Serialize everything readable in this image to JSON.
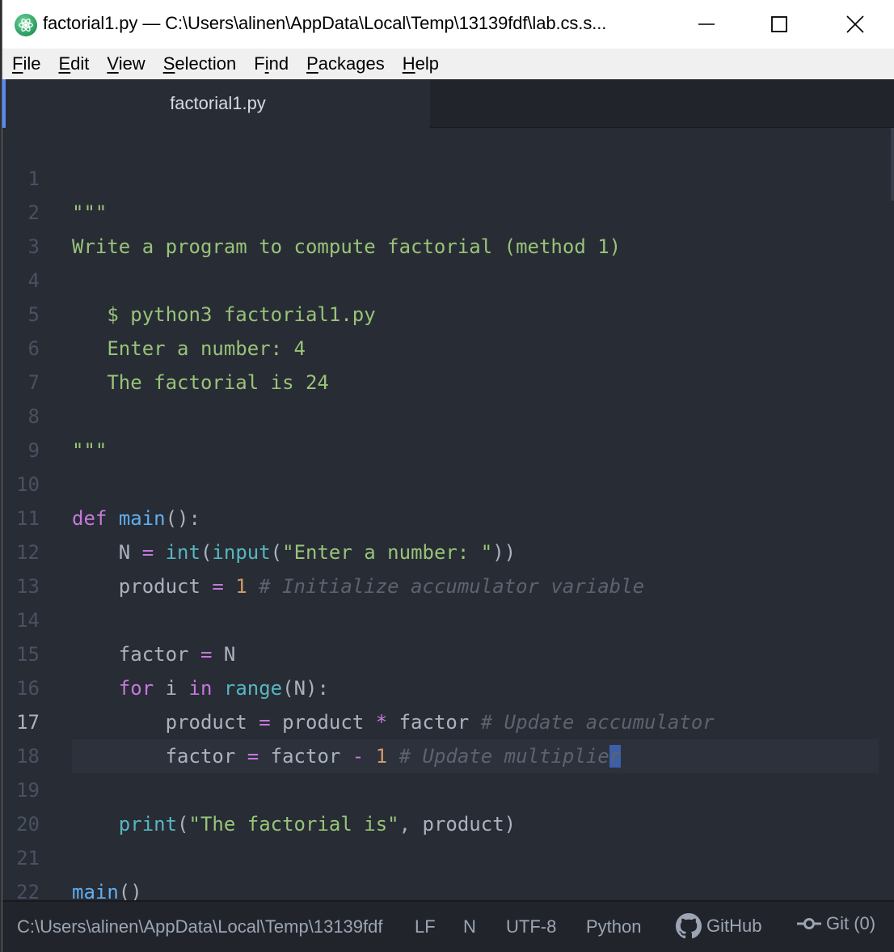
{
  "window": {
    "title": "factorial1.py — C:\\Users\\alinen\\AppData\\Local\\Temp\\13139fdf\\lab.cs.s...",
    "app_icon": "atom-icon",
    "controls": {
      "minimize": "minimize-icon",
      "maximize": "maximize-icon",
      "close": "close-icon"
    }
  },
  "menu": {
    "items": [
      {
        "label": "File",
        "accel": "F",
        "rest": "ile"
      },
      {
        "label": "Edit",
        "accel": "E",
        "rest": "dit"
      },
      {
        "label": "View",
        "accel": "V",
        "rest": "iew"
      },
      {
        "label": "Selection",
        "accel": "S",
        "rest": "election"
      },
      {
        "label": "Find",
        "pre": "F",
        "accel": "i",
        "rest": "nd"
      },
      {
        "label": "Packages",
        "accel": "P",
        "rest": "ackages"
      },
      {
        "label": "Help",
        "accel": "H",
        "rest": "elp"
      }
    ]
  },
  "tabs": [
    {
      "label": "factorial1.py",
      "active": true
    }
  ],
  "editor": {
    "language": "Python",
    "cursor_line": 17,
    "lines": [
      {
        "n": "1",
        "text": "\"\"\""
      },
      {
        "n": "2",
        "text": "Write a program to compute factorial (method 1)"
      },
      {
        "n": "3",
        "text": ""
      },
      {
        "n": "4",
        "text": "   $ python3 factorial1.py"
      },
      {
        "n": "5",
        "text": "   Enter a number: 4"
      },
      {
        "n": "6",
        "text": "   The factorial is 24"
      },
      {
        "n": "7",
        "text": ""
      },
      {
        "n": "8",
        "text": "\"\"\""
      },
      {
        "n": "9",
        "text": ""
      },
      {
        "n": "10",
        "text": "def main():"
      },
      {
        "n": "11",
        "text": "    N = int(input(\"Enter a number: \"))"
      },
      {
        "n": "12",
        "text": "    product = 1 # Initialize accumulator variable"
      },
      {
        "n": "13",
        "text": ""
      },
      {
        "n": "14",
        "text": "    factor = N"
      },
      {
        "n": "15",
        "text": "    for i in range(N):"
      },
      {
        "n": "16",
        "text": "        product = product * factor # Update accumulator"
      },
      {
        "n": "17",
        "text": "        factor = factor - 1 # Update multiplier"
      },
      {
        "n": "18",
        "text": ""
      },
      {
        "n": "19",
        "text": "    print(\"The factorial is\", product)"
      },
      {
        "n": "20",
        "text": ""
      },
      {
        "n": "21",
        "text": "main()"
      },
      {
        "n": "22",
        "text": ""
      }
    ]
  },
  "status": {
    "path": "C:\\Users\\alinen\\AppData\\Local\\Temp\\13139fdf",
    "line_ending": "LF",
    "indicator": "N",
    "encoding": "UTF-8",
    "grammar": "Python",
    "github": "GitHub",
    "git": "Git (0)"
  },
  "colors": {
    "accent": "#568af2",
    "string": "#98c379",
    "keyword": "#c678dd",
    "function": "#61afef",
    "builtin": "#56b6c2",
    "number": "#d19a66",
    "comment": "#5c6370",
    "selection": "#3d5fa8"
  }
}
